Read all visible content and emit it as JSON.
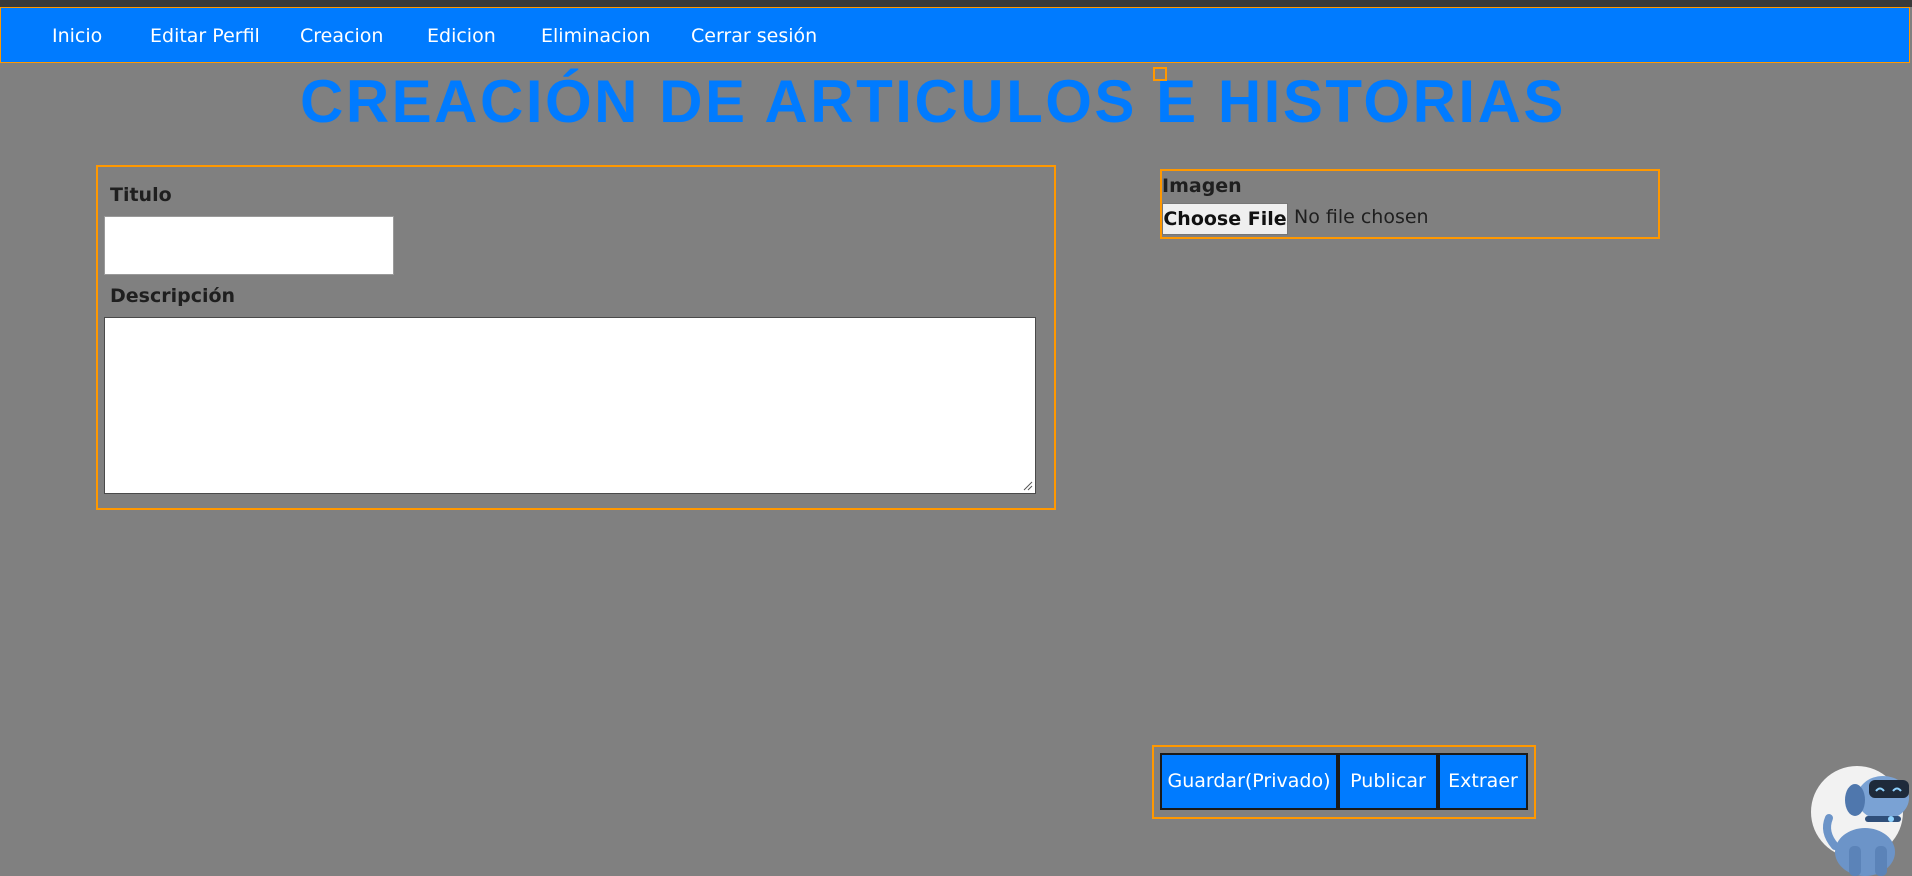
{
  "nav": {
    "items": [
      {
        "label": "Inicio"
      },
      {
        "label": "Editar Perfil"
      },
      {
        "label": "Creacion"
      },
      {
        "label": "Edicion"
      },
      {
        "label": "Eliminacion"
      },
      {
        "label": "Cerrar sesión"
      }
    ]
  },
  "page": {
    "title": "CREACIÓN DE ARTICULOS E HISTORIAS"
  },
  "form": {
    "title_label": "Titulo",
    "title_value": "",
    "description_label": "Descripción",
    "description_value": ""
  },
  "image": {
    "label": "Imagen",
    "button_label": "Choose File",
    "status": "No file chosen"
  },
  "actions": {
    "save_private": "Guardar(Privado)",
    "publish": "Publicar",
    "extract": "Extraer"
  },
  "icons": {
    "mascot": "robot-dog-icon",
    "resize": "resize-grip-icon"
  },
  "colors": {
    "background": "#808080",
    "primary": "#007bff",
    "accent_border": "#ff9800",
    "nav_text": "#ffffff",
    "label_text": "#1f1f1f"
  }
}
